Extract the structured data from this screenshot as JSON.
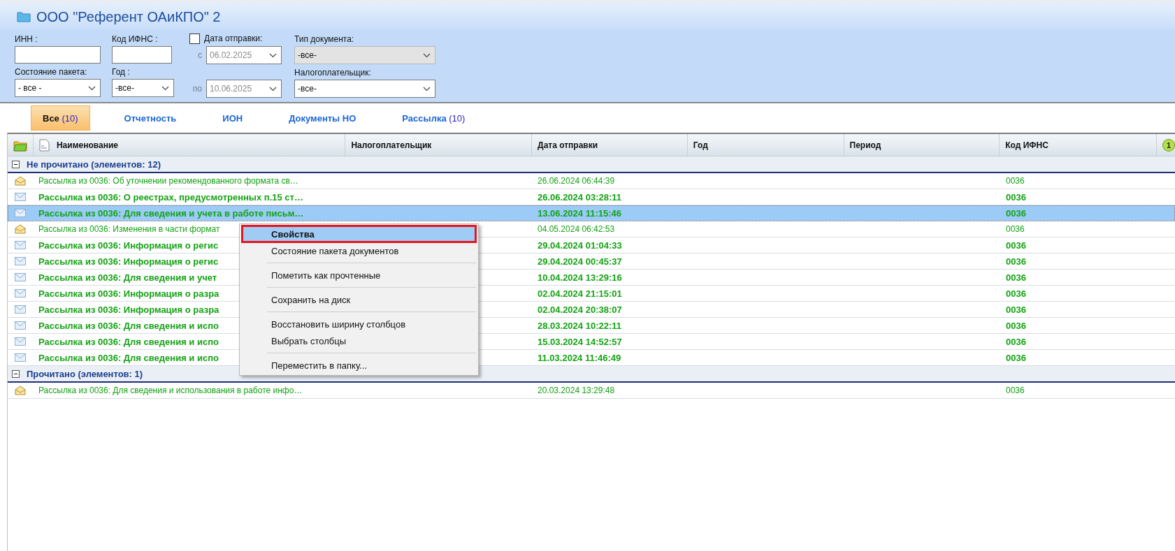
{
  "window": {
    "title": "ООО \"Референт ОАиКПО\" 2"
  },
  "filters": {
    "inn": {
      "label": "ИНН :"
    },
    "ifns": {
      "label": "Код ИФНС :"
    },
    "package_state": {
      "label": "Состояние пакета:",
      "value": "- все -"
    },
    "year": {
      "label": "Год :",
      "value": "-все-"
    },
    "send_date": {
      "label": "Дата отправки:",
      "checked": false,
      "from": {
        "prefix": "с",
        "value": "06.02.2025",
        "disabled": true
      },
      "to": {
        "prefix": "по",
        "value": "10.06.2025",
        "disabled": true
      }
    },
    "doc_type": {
      "label": "Тип документа:",
      "value": "-все-",
      "disabled": true
    },
    "taxpayer": {
      "label": "Налогоплательщик:",
      "value": "-все-",
      "disabled": false
    }
  },
  "tabs": [
    {
      "label": "Все",
      "count": "(10)",
      "selected": true
    },
    {
      "label": "Отчетность",
      "selected": false
    },
    {
      "label": "ИОН",
      "selected": false
    },
    {
      "label": "Документы НО",
      "selected": false
    },
    {
      "label": "Рассылка",
      "count": "(10)",
      "selected": false
    }
  ],
  "table": {
    "columns": [
      "Наименование",
      "Налогоплательщик",
      "Дата отправки",
      "Год",
      "Период",
      "Код ИФНС"
    ],
    "badge": "1",
    "groups": [
      {
        "title": "Не прочитано (элементов: 12)",
        "expanded": true,
        "rows": [
          {
            "name": "Рассылка из 0036: Об уточнении рекомендованного формата св…",
            "date": "26.06.2024 06:44:39",
            "code": "0036",
            "opened": true,
            "selected": false
          },
          {
            "name": "Рассылка из 0036: О реестрах, предусмотренных п.15 ст…",
            "date": "26.06.2024 03:28:11",
            "code": "0036",
            "opened": false,
            "selected": false
          },
          {
            "name": "Рассылка из 0036: Для сведения и учета в работе письм…",
            "date": "13.06.2024 11:15:46",
            "code": "0036",
            "opened": false,
            "selected": true
          },
          {
            "name": "Рассылка из 0036: Изменения в части формат",
            "date": "04.05.2024 06:42:53",
            "code": "0036",
            "opened": true,
            "selected": false
          },
          {
            "name": "Рассылка из 0036: Информация о регис",
            "date": "29.04.2024 01:04:33",
            "code": "0036",
            "opened": false,
            "selected": false
          },
          {
            "name": "Рассылка из 0036: Информация о регис",
            "date": "29.04.2024 00:45:37",
            "code": "0036",
            "opened": false,
            "selected": false
          },
          {
            "name": "Рассылка из 0036: Для сведения и учет",
            "date": "10.04.2024 13:29:16",
            "code": "0036",
            "opened": false,
            "selected": false
          },
          {
            "name": "Рассылка из 0036: Информация о разра",
            "date": "02.04.2024 21:15:01",
            "code": "0036",
            "opened": false,
            "selected": false
          },
          {
            "name": "Рассылка из 0036: Информация о разра",
            "date": "02.04.2024 20:38:07",
            "code": "0036",
            "opened": false,
            "selected": false
          },
          {
            "name": "Рассылка из 0036: Для сведения и испо",
            "date": "28.03.2024 10:22:11",
            "code": "0036",
            "opened": false,
            "selected": false
          },
          {
            "name": "Рассылка из 0036: Для сведения и испо",
            "date": "15.03.2024 14:52:57",
            "code": "0036",
            "opened": false,
            "selected": false
          },
          {
            "name": "Рассылка из 0036: Для сведения и испо",
            "date": "11.03.2024 11:46:49",
            "code": "0036",
            "opened": false,
            "selected": false
          }
        ]
      },
      {
        "title": "Прочитано (элементов: 1)",
        "expanded": true,
        "rows": [
          {
            "name": "Рассылка из 0036: Для сведения и использования в работе инфо…",
            "date": "20.03.2024 13:29:48",
            "code": "0036",
            "opened": true,
            "selected": false
          }
        ]
      }
    ]
  },
  "context_menu": {
    "items": [
      {
        "kind": "item",
        "label": "Свойства",
        "selected": true
      },
      {
        "kind": "item",
        "label": "Состояние пакета документов",
        "selected": false
      },
      {
        "kind": "separator"
      },
      {
        "kind": "item",
        "label": "Пометить как прочтенные",
        "selected": false
      },
      {
        "kind": "separator"
      },
      {
        "kind": "item",
        "label": "Сохранить на диск",
        "selected": false
      },
      {
        "kind": "separator"
      },
      {
        "kind": "item",
        "label": "Восстановить ширину столбцов",
        "selected": false
      },
      {
        "kind": "item",
        "label": "Выбрать столбцы",
        "selected": false
      },
      {
        "kind": "separator"
      },
      {
        "kind": "item",
        "label": "Переместить в папку...",
        "selected": false
      }
    ]
  }
}
